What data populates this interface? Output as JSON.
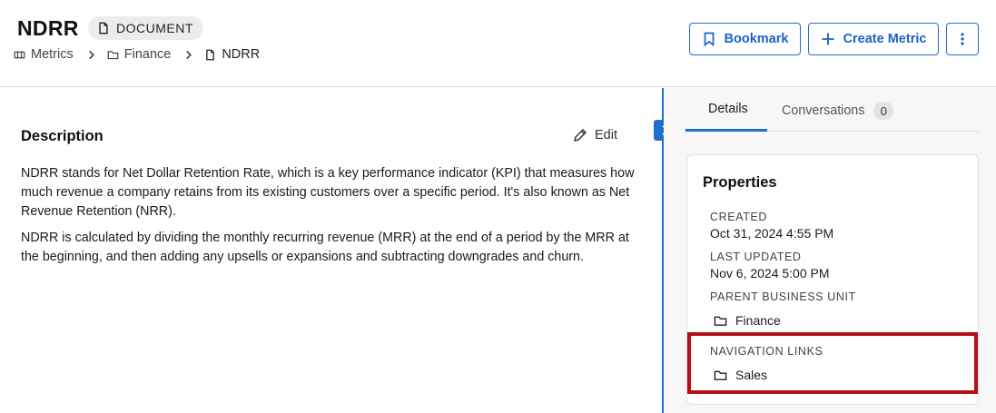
{
  "header": {
    "title": "NDRR",
    "type_badge": "DOCUMENT",
    "breadcrumb": [
      {
        "label": "Metrics",
        "icon": "metrics-icon"
      },
      {
        "label": "Finance",
        "icon": "folder-icon"
      },
      {
        "label": "NDRR",
        "icon": "document-icon"
      }
    ],
    "actions": {
      "bookmark_label": "Bookmark",
      "create_metric_label": "Create Metric"
    }
  },
  "main": {
    "description_heading": "Description",
    "edit_label": "Edit",
    "paragraphs": [
      "NDRR stands for Net Dollar Retention Rate, which is a key performance indicator (KPI) that measures how much revenue a company retains from its existing customers over a specific period. It's also known as Net Revenue Retention (NRR).",
      "NDRR is calculated by dividing the monthly recurring revenue (MRR) at the end of a period by the MRR at the beginning, and then adding any upsells or expansions and subtracting downgrades and churn."
    ]
  },
  "sidebar": {
    "tabs": [
      {
        "label": "Details",
        "active": true
      },
      {
        "label": "Conversations",
        "count": "0"
      }
    ],
    "properties": {
      "title": "Properties",
      "created_label": "CREATED",
      "created_value": "Oct 31, 2024 4:55 PM",
      "updated_label": "LAST UPDATED",
      "updated_value": "Nov 6, 2024 5:00 PM",
      "parent_label": "PARENT BUSINESS UNIT",
      "parent_value": "Finance",
      "nav_label": "NAVIGATION LINKS",
      "nav_value": "Sales"
    }
  },
  "colors": {
    "accent": "#1f6fd1",
    "highlight": "#b40f14",
    "sidebar_bg": "#f7f7f7"
  }
}
